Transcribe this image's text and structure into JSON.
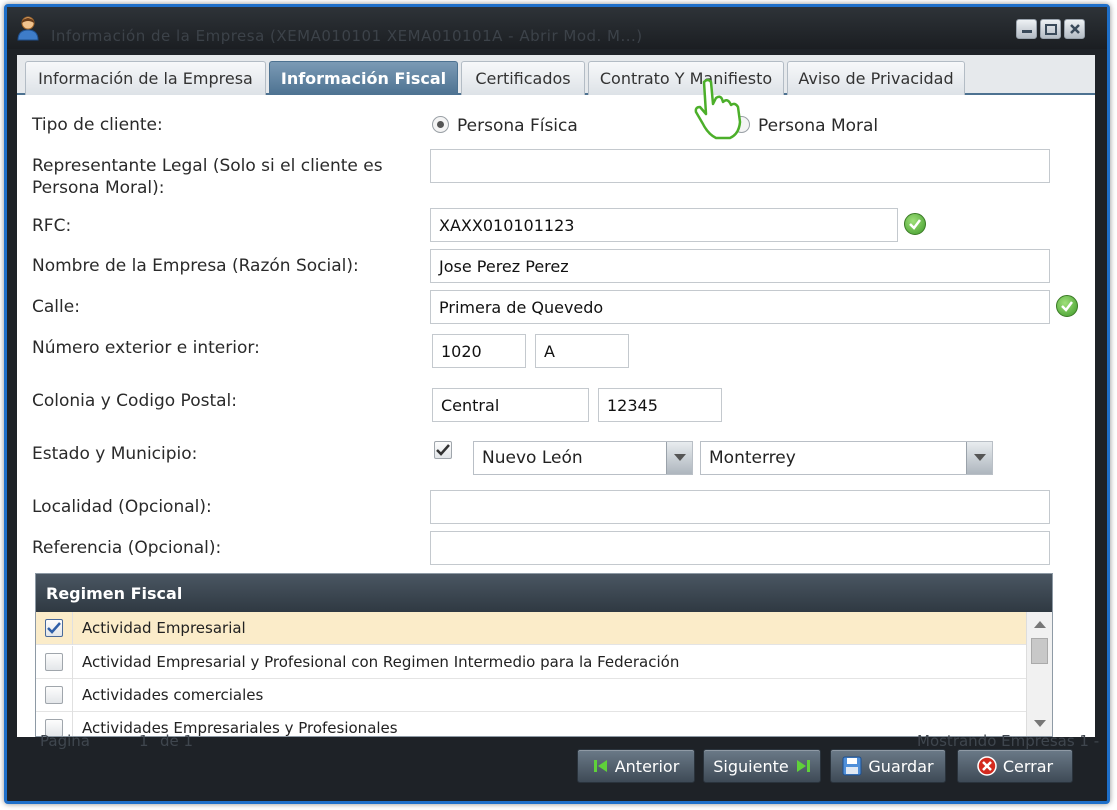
{
  "window": {
    "ghost_title": "Información de la Empresa (XEMA010101 XEMA010101A - Abrir Mod. M...)"
  },
  "tabs": [
    {
      "label": "Información de la Empresa",
      "active": false
    },
    {
      "label": "Información Fiscal",
      "active": true
    },
    {
      "label": "Certificados",
      "active": false
    },
    {
      "label": "Contrato Y Manifiesto",
      "active": false
    },
    {
      "label": "Aviso de Privacidad",
      "active": false
    }
  ],
  "form": {
    "tipo_cliente": {
      "label": "Tipo de cliente:",
      "option_fisica": "Persona Física",
      "option_moral": "Persona Moral",
      "selected": "Persona Física"
    },
    "representante": {
      "label_line1": "Representante Legal (Solo si el cliente es",
      "label_line2": "Persona Moral):",
      "value": ""
    },
    "rfc": {
      "label": "RFC:",
      "value": "XAXX010101123"
    },
    "nombre": {
      "label": "Nombre de la Empresa (Razón Social):",
      "value": "Jose Perez Perez"
    },
    "calle": {
      "label": "Calle:",
      "value": "Primera de Quevedo"
    },
    "numero": {
      "label": "Número exterior e interior:",
      "exterior": "1020",
      "interior": "A"
    },
    "colonia": {
      "label": "Colonia y Codigo Postal:",
      "colonia": "Central",
      "cp": "12345"
    },
    "estado": {
      "label": "Estado y Municipio:",
      "checked": true,
      "estado": "Nuevo León",
      "municipio": "Monterrey"
    },
    "localidad": {
      "label": "Localidad (Opcional):",
      "value": ""
    },
    "referencia": {
      "label": "Referencia (Opcional):",
      "value": ""
    }
  },
  "regimen": {
    "header": "Regimen Fiscal",
    "rows": [
      {
        "label": "Actividad Empresarial",
        "checked": true
      },
      {
        "label": "Actividad Empresarial y Profesional con Regimen Intermedio para la Federación",
        "checked": false
      },
      {
        "label": "Actividades comerciales",
        "checked": false
      },
      {
        "label": "Actividades Empresariales y Profesionales",
        "checked": false
      }
    ]
  },
  "pager": {
    "pagina": "Pagina",
    "page": "1",
    "de": "de 1",
    "mostrando": "Mostrando Empresas 1 -"
  },
  "buttons": {
    "anterior": "Anterior",
    "siguiente": "Siguiente",
    "guardar": "Guardar",
    "cerrar": "Cerrar"
  },
  "colors": {
    "window_border": "#1e6fc9",
    "active_tab": "#4d7291",
    "selected_row": "#fbecc9",
    "ok_green": "#3f9a2a",
    "close_red": "#d42a1e"
  }
}
